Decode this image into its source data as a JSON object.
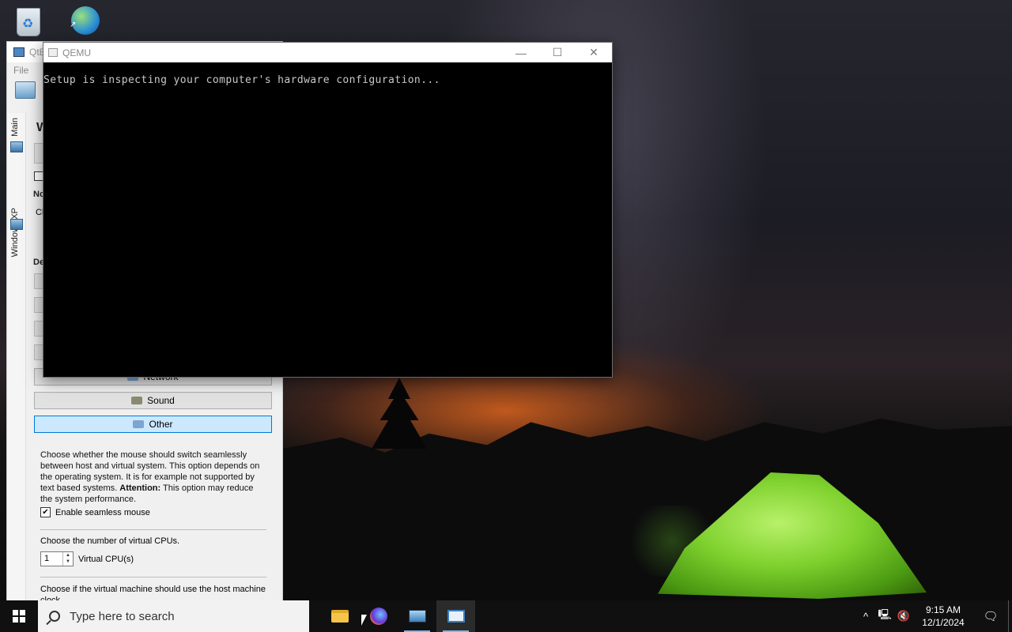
{
  "desktop": {
    "icons": [
      "recycle-bin-icon",
      "internet-download-manager-icon"
    ]
  },
  "qtemu": {
    "title": "QtE",
    "menu": [
      "File",
      "F"
    ],
    "side_tabs": [
      "Main",
      "Windows XP"
    ],
    "partial": {
      "heading": "W",
      "no": "No",
      "cl": "Cl",
      "de": "De"
    },
    "devices": [
      {
        "label": "Network",
        "icon": "network-icon"
      },
      {
        "label": "Sound",
        "icon": "speaker-icon"
      },
      {
        "label": "Other",
        "icon": "computer-icon",
        "selected": true
      }
    ],
    "other": {
      "desc_prefix": "Choose whether the mouse should switch seamlessly between host and virtual system. This option depends on the operating system. It is for example not supported by text based systems. ",
      "desc_bold": "Attention:",
      "desc_suffix": " This option may reduce the system performance.",
      "seamless_label": "Enable seamless mouse",
      "seamless_checked": true,
      "cpu_prompt": "Choose the number of virtual CPUs.",
      "cpu_value": "1",
      "cpu_suffix": "Virtual CPU(s)",
      "clock_prompt": "Choose if the virtual machine should use the host machine clock."
    }
  },
  "qemu": {
    "title": "QEMU",
    "controls": {
      "minimize": "—",
      "maximize": "☐",
      "close": "✕"
    },
    "console_text": "Setup is inspecting your computer's hardware configuration..."
  },
  "taskbar": {
    "search_placeholder": "Type here to search",
    "apps": [
      "file-explorer-icon",
      "firefox-icon",
      "qtemu-icon",
      "qemu-icon"
    ],
    "time": "9:15 AM",
    "date": "12/1/2024",
    "tray_icons": [
      "chevron-up-icon",
      "network-icon",
      "volume-muted-icon"
    ]
  },
  "colors": {
    "taskbar": "#101010",
    "selected_button": "#cce8ff",
    "accent": "#0078d7"
  }
}
